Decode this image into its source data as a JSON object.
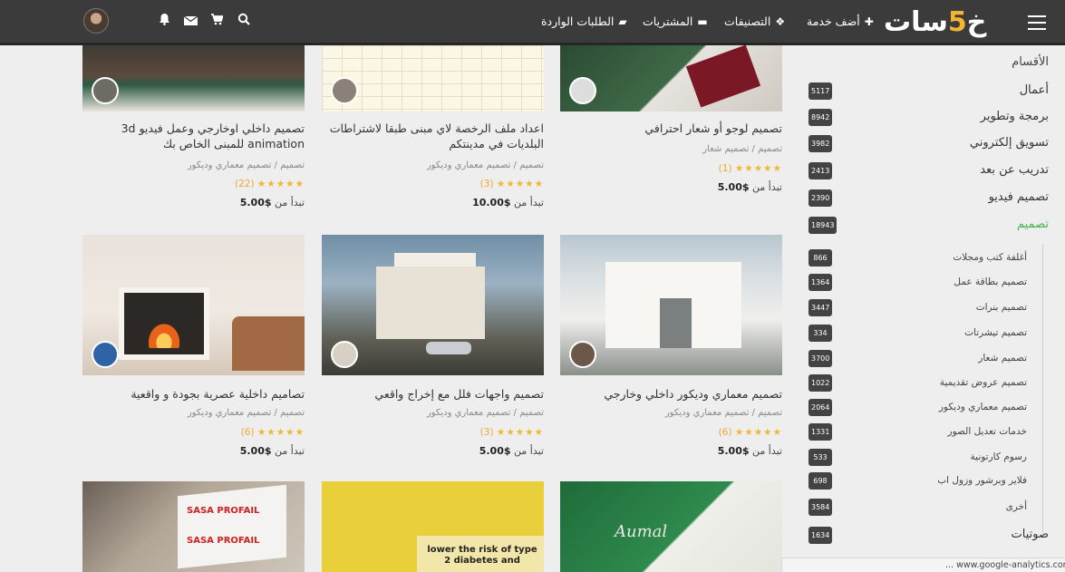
{
  "topbar": {
    "logo_main": "خمسات",
    "logo_five": "5",
    "add_service": "أضف خدمة",
    "categories": "التصنيفات",
    "purchases": "المشتريات",
    "incoming_orders": "الطلبات الواردة"
  },
  "sidebar": {
    "title": "الأقسام",
    "categories": [
      {
        "label": "أعمال",
        "count": "5117"
      },
      {
        "label": "برمجة وتطوير",
        "count": "8942"
      },
      {
        "label": "تسويق إلكتروني",
        "count": "3982"
      },
      {
        "label": "تدريب عن بعد",
        "count": "2413"
      },
      {
        "label": "تصميم فيديو",
        "count": "2390"
      },
      {
        "label": "تصميم",
        "count": "18943"
      }
    ],
    "subcategories": [
      {
        "label": "أغلفة كتب ومجلات",
        "count": "866"
      },
      {
        "label": "تصميم بطاقة عمل",
        "count": "1364"
      },
      {
        "label": "تصميم بنرات",
        "count": "3447"
      },
      {
        "label": "تصميم تيشرتات",
        "count": "334"
      },
      {
        "label": "تصميم شعار",
        "count": "3700"
      },
      {
        "label": "تصميم عروض تقديمية",
        "count": "1022"
      },
      {
        "label": "تصميم معماري وديكور",
        "count": "2064"
      },
      {
        "label": "خدمات تعديل الصور",
        "count": "1331"
      },
      {
        "label": "رسوم كارتونية",
        "count": "533"
      },
      {
        "label": "فلاير وبرشور وزول اب",
        "count": "698"
      },
      {
        "label": "أخرى",
        "count": "3584"
      }
    ],
    "next_category": {
      "label": "صوتيات",
      "count": "1634"
    }
  },
  "cards": [
    {
      "title": "تصميم لوجو أو شعار احترافي",
      "category": "تصميم / تصميم شعار",
      "stars": "★★★★★",
      "count": "(1)",
      "price_prefix": "تبدأ من",
      "price": "$5.00"
    },
    {
      "title": "اعداد ملف الرخصة لاي مبنى طبقا لاشتراطات البلديات في مدينتكم",
      "category": "تصميم / تصميم معماري وديكور",
      "stars": "★★★★★",
      "count": "(3)",
      "price_prefix": "تبدأ من",
      "price": "$10.00"
    },
    {
      "title": "تصميم داخلي اوخارجي وعمل فيديو 3d animation للمبنى الخاص بك",
      "category": "تصميم / تصميم معماري وديكور",
      "stars": "★★★★★",
      "count": "(22)",
      "price_prefix": "تبدأ من",
      "price": "$5.00"
    },
    {
      "title": "تصميم معماري وديكور داخلي وخارجي",
      "category": "تصميم / تصميم معماري وديكور",
      "stars": "★★★★★",
      "count": "(6)",
      "price_prefix": "تبدأ من",
      "price": "$5.00"
    },
    {
      "title": "تصميم واجهات فلل مع إخراج واقعي",
      "category": "تصميم / تصميم معماري وديكور",
      "stars": "★★★★★",
      "count": "(3)",
      "price_prefix": "تبدأ من",
      "price": "$5.00"
    },
    {
      "title": "تصاميم داخلية عصرية بجودة و واقعية",
      "category": "تصميم / تصميم معماري وديكور",
      "stars": "★★★★★",
      "count": "(6)",
      "price_prefix": "تبدأ من",
      "price": "$5.00"
    }
  ],
  "thumb_text": {
    "sasa1": "SASA PROFAIL",
    "sasa2": "SASA PROFAIL",
    "diabetes": "lower the risk of type 2 diabetes and",
    "script": "Aumal"
  },
  "statusbar": "... www.google-analytics.com",
  "colors": {
    "topbar": "#3b3b3b",
    "accent_green": "#3fb549",
    "star": "#f2b631",
    "badge": "#434343"
  }
}
